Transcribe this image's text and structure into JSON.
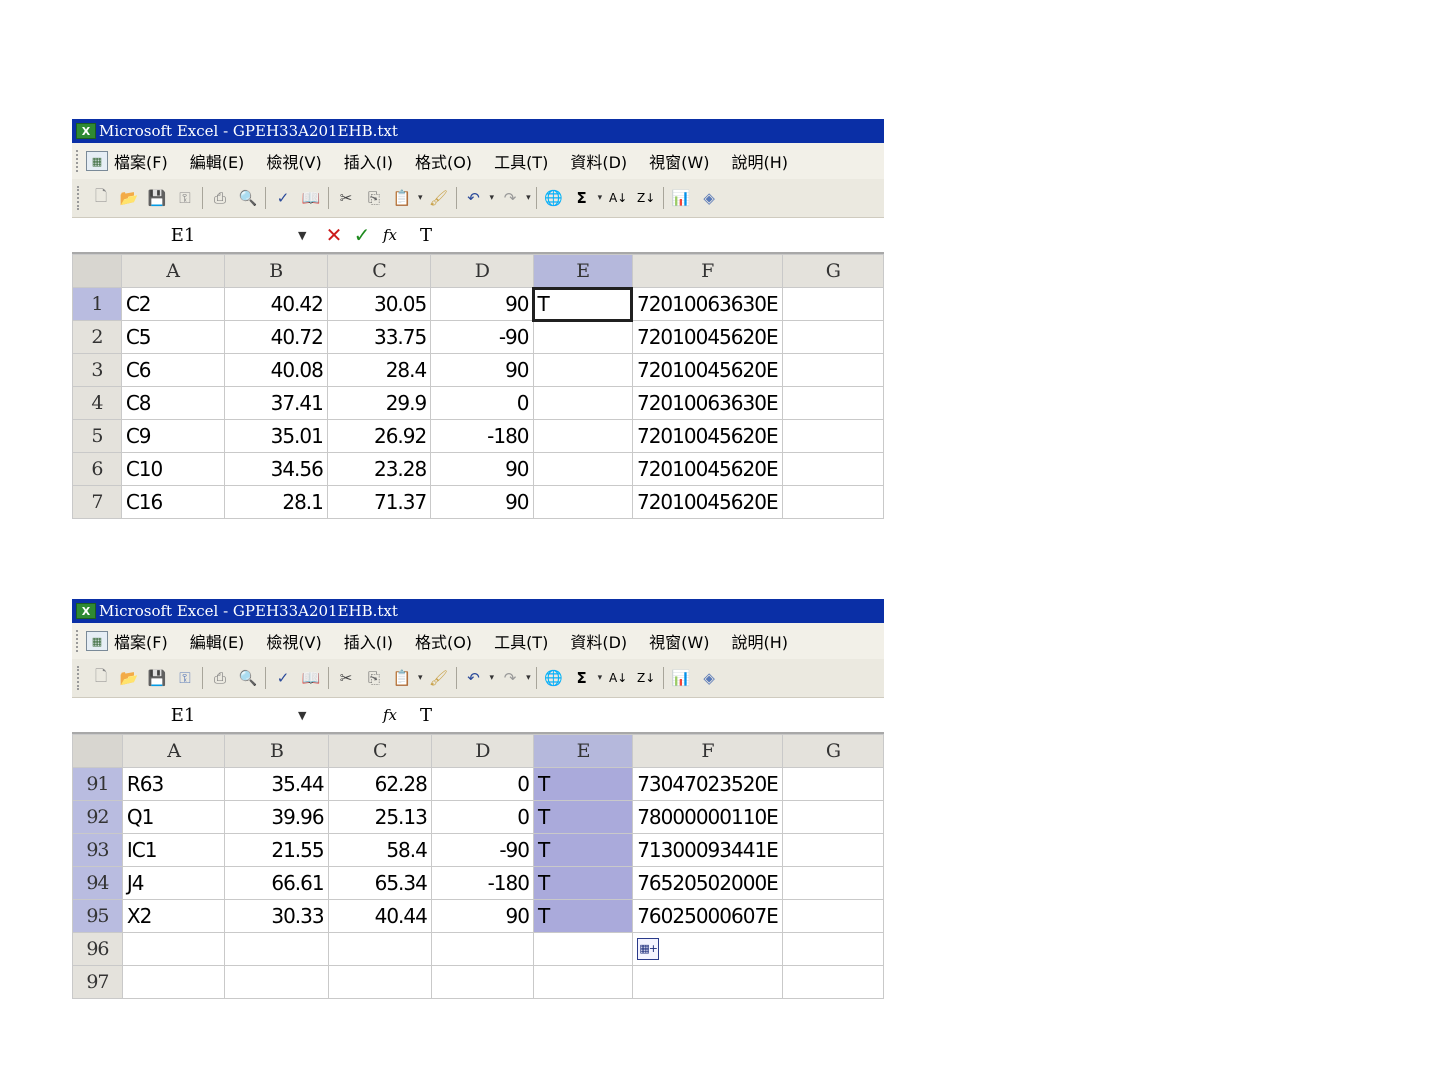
{
  "windows": [
    {
      "title": "Microsoft Excel - GPEH33A201EHB.txt",
      "menu": [
        "檔案(F)",
        "編輯(E)",
        "檢視(V)",
        "插入(I)",
        "格式(O)",
        "工具(T)",
        "資料(D)",
        "視窗(W)",
        "說明(H)"
      ],
      "name_box": "E1",
      "formula": "T",
      "editing": true,
      "columns": [
        "A",
        "B",
        "C",
        "D",
        "E",
        "F",
        "G"
      ],
      "rows": [
        {
          "n": "1",
          "A": "C2",
          "B": "40.42",
          "C": "30.05",
          "D": "90",
          "E": "T",
          "F": "72010063630E",
          "G": ""
        },
        {
          "n": "2",
          "A": "C5",
          "B": "40.72",
          "C": "33.75",
          "D": "-90",
          "E": "",
          "F": "72010045620E",
          "G": ""
        },
        {
          "n": "3",
          "A": "C6",
          "B": "40.08",
          "C": "28.4",
          "D": "90",
          "E": "",
          "F": "72010045620E",
          "G": ""
        },
        {
          "n": "4",
          "A": "C8",
          "B": "37.41",
          "C": "29.9",
          "D": "0",
          "E": "",
          "F": "72010063630E",
          "G": ""
        },
        {
          "n": "5",
          "A": "C9",
          "B": "35.01",
          "C": "26.92",
          "D": "-180",
          "E": "",
          "F": "72010045620E",
          "G": ""
        },
        {
          "n": "6",
          "A": "C10",
          "B": "34.56",
          "C": "23.28",
          "D": "90",
          "E": "",
          "F": "72010045620E",
          "G": ""
        },
        {
          "n": "7",
          "A": "C16",
          "B": "28.1",
          "C": "71.37",
          "D": "90",
          "E": "",
          "F": "72010045620E",
          "G": ""
        }
      ]
    },
    {
      "title": "Microsoft Excel - GPEH33A201EHB.txt",
      "menu": [
        "檔案(F)",
        "編輯(E)",
        "檢視(V)",
        "插入(I)",
        "格式(O)",
        "工具(T)",
        "資料(D)",
        "視窗(W)",
        "說明(H)"
      ],
      "name_box": "E1",
      "formula": "T",
      "editing": false,
      "columns": [
        "A",
        "B",
        "C",
        "D",
        "E",
        "F",
        "G"
      ],
      "rows": [
        {
          "n": "91",
          "A": "R63",
          "B": "35.44",
          "C": "62.28",
          "D": "0",
          "E": "T",
          "F": "73047023520E",
          "G": ""
        },
        {
          "n": "92",
          "A": "Q1",
          "B": "39.96",
          "C": "25.13",
          "D": "0",
          "E": "T",
          "F": "78000000110E",
          "G": ""
        },
        {
          "n": "93",
          "A": "IC1",
          "B": "21.55",
          "C": "58.4",
          "D": "-90",
          "E": "T",
          "F": "71300093441E",
          "G": ""
        },
        {
          "n": "94",
          "A": "J4",
          "B": "66.61",
          "C": "65.34",
          "D": "-180",
          "E": "T",
          "F": "76520502000E",
          "G": ""
        },
        {
          "n": "95",
          "A": "X2",
          "B": "30.33",
          "C": "40.44",
          "D": "90",
          "E": "T",
          "F": "76025000607E",
          "G": ""
        },
        {
          "n": "96",
          "A": "",
          "B": "",
          "C": "",
          "D": "",
          "E": "",
          "F": "",
          "G": ""
        },
        {
          "n": "97",
          "A": "",
          "B": "",
          "C": "",
          "D": "",
          "E": "",
          "F": "",
          "G": ""
        }
      ]
    }
  ],
  "toolbar_icons": [
    "new-icon",
    "open-icon",
    "save-icon",
    "permission-icon",
    "print-icon",
    "print-preview-icon",
    "spelling-icon",
    "research-icon",
    "cut-icon",
    "copy-icon",
    "paste-icon",
    "format-painter-icon",
    "undo-icon",
    "redo-icon",
    "hyperlink-icon",
    "autosum-icon",
    "sort-ascending-icon",
    "sort-descending-icon",
    "chart-wizard-icon",
    "drawing-icon"
  ],
  "colors": {
    "titlebar": "#0a2fa6",
    "selection": "#aaaadb",
    "header": "#e4e2dc"
  }
}
